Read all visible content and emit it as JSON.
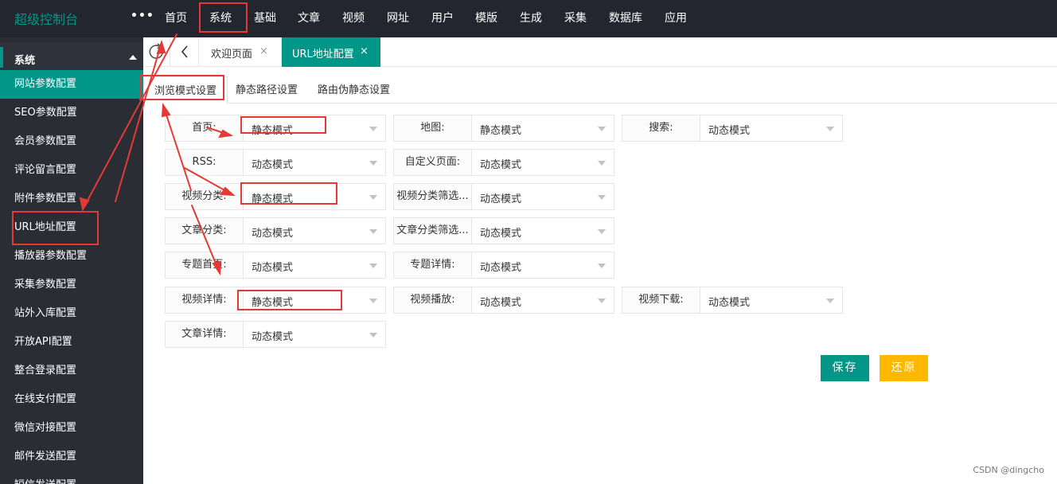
{
  "brand": "超级控制台",
  "more": "•••",
  "nav": [
    "首页",
    "系统",
    "基础",
    "文章",
    "视频",
    "网址",
    "用户",
    "模版",
    "生成",
    "采集",
    "数据库",
    "应用"
  ],
  "sidebar": {
    "group_label": "系统",
    "items": [
      "网站参数配置",
      "SEO参数配置",
      "会员参数配置",
      "评论留言配置",
      "附件参数配置",
      "URL地址配置",
      "播放器参数配置",
      "采集参数配置",
      "站外入库配置",
      "开放API配置",
      "整合登录配置",
      "在线支付配置",
      "微信对接配置",
      "邮件发送配置",
      "短信发送配置"
    ]
  },
  "tabs": {
    "welcome": "欢迎页面",
    "active": "URL地址配置",
    "close": "×"
  },
  "subtabs": [
    "浏览模式设置",
    "静态路径设置",
    "路由伪静态设置"
  ],
  "form": [
    {
      "label": "首页:",
      "value": "静态模式"
    },
    {
      "label": "地图:",
      "value": "静态模式"
    },
    {
      "label": "搜索:",
      "value": "动态模式"
    },
    {
      "label": "RSS:",
      "value": "动态模式"
    },
    {
      "label": "自定义页面:",
      "value": "动态模式"
    },
    {
      "label": "视频分类:",
      "value": "静态模式"
    },
    {
      "label": "视频分类筛选...",
      "value": "动态模式"
    },
    {
      "label": "文章分类:",
      "value": "动态模式"
    },
    {
      "label": "文章分类筛选...",
      "value": "动态模式"
    },
    {
      "label": "专题首页:",
      "value": "动态模式"
    },
    {
      "label": "专题详情:",
      "value": "动态模式"
    },
    {
      "label": "视频详情:",
      "value": "静态模式"
    },
    {
      "label": "视频播放:",
      "value": "动态模式"
    },
    {
      "label": "视频下载:",
      "value": "动态模式"
    },
    {
      "label": "文章详情:",
      "value": "动态模式"
    }
  ],
  "buttons": {
    "save": "保存",
    "reset": "还原"
  },
  "watermark": "CSDN @dingcho",
  "colors": {
    "accent": "#009688",
    "warn": "#ffb800",
    "annotation": "#e53935",
    "topbar": "#23262e",
    "sidebar": "#2a2d34"
  }
}
